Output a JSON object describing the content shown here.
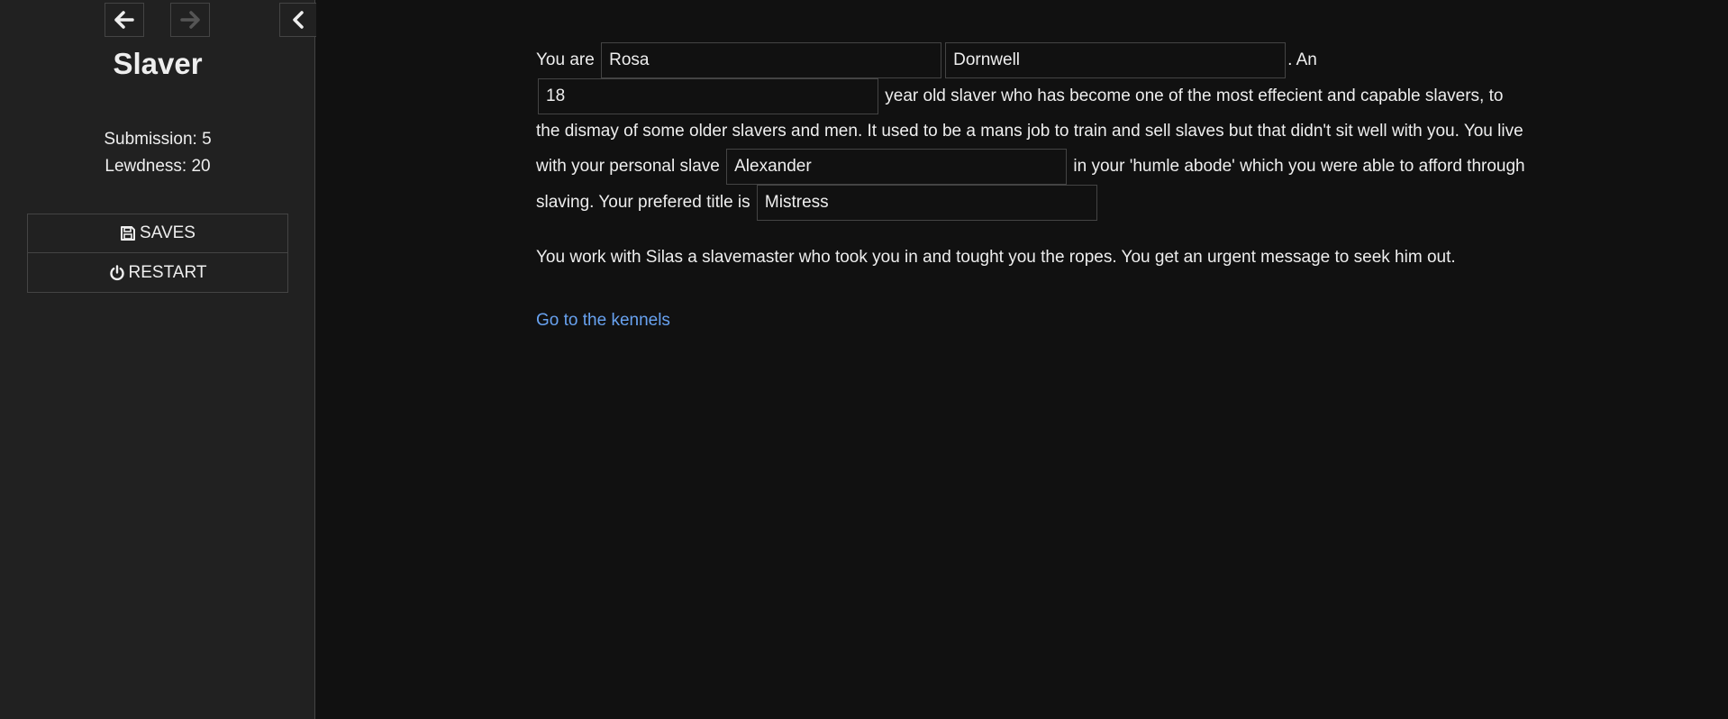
{
  "sidebar": {
    "story_title": "Slaver",
    "stats": {
      "submission": "Submission: 5",
      "lewdness": "Lewdness: 20"
    },
    "menu": {
      "saves_label": "SAVES",
      "restart_label": "RESTART"
    },
    "icons": {
      "back": "arrow-left-icon",
      "forward": "arrow-right-icon",
      "collapse": "chevron-left-icon",
      "saves": "floppy-disk-icon",
      "restart": "power-icon"
    }
  },
  "passage": {
    "p1_part1": "You are",
    "first_name": "Rosa",
    "last_name": "Dornwell",
    "p1_part2": ". An",
    "age": "18",
    "p1_part3": "year old slaver who has become one of the most effecient and capable slavers, to the dismay of some older slavers and men. It used to be a mans job to train and sell slaves but that didn't sit well with you. You live with your personal slave",
    "slave_name": "Alexander",
    "p1_part4": "in your 'humle abode' which you were able to afford through slaving. Your prefered title is",
    "title": "Mistress",
    "p2": "You work with Silas a slavemaster who took you in and tought you the ropes. You get an urgent message to seek him out.",
    "link": "Go to the kennels"
  },
  "colors": {
    "background": "#111111",
    "sidebar_background": "#212121",
    "border": "#444444",
    "text": "#eeeeee",
    "link": "#68a2f0"
  }
}
